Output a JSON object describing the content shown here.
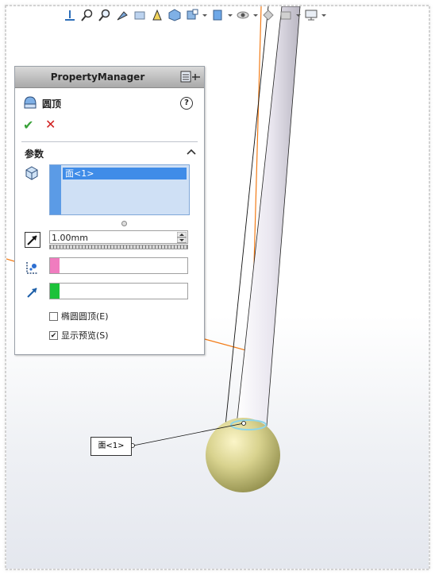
{
  "property_manager": {
    "title": "PropertyManager",
    "feature_name": "圆顶",
    "help_label": "?",
    "ok_label": "✔",
    "cancel_label": "✕",
    "group_title": "参数",
    "selection_items": [
      "面<1>"
    ],
    "distance_value": "1.00mm",
    "checkboxes": [
      {
        "label": "椭圆圆顶(E)",
        "checked": false
      },
      {
        "label": "显示预览(S)",
        "checked": true
      }
    ]
  },
  "callout": {
    "label": "面<1>"
  },
  "colors": {
    "selection_blue": "#3f8ce8",
    "swatch_pink": "#f07cbf",
    "swatch_green": "#1cc23a",
    "model_edge_orange": "#f27b16"
  }
}
